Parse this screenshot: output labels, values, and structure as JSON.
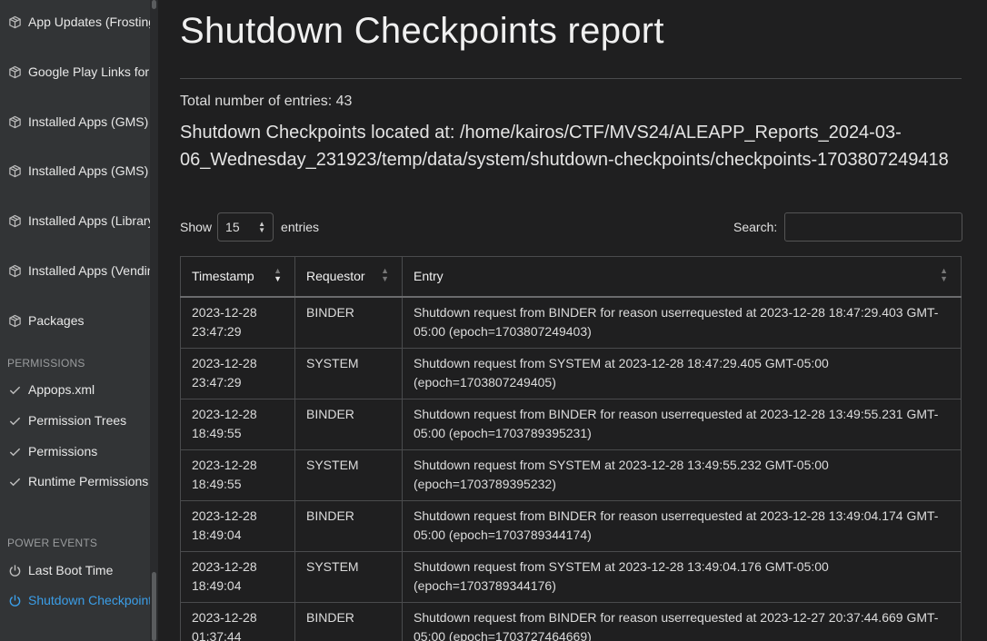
{
  "sidebar": {
    "items_top": [
      {
        "label": "App Updates (Frosting.db)",
        "icon": "package-icon"
      },
      {
        "label": "Google Play Links for Apps",
        "icon": "package-icon"
      },
      {
        "label": "Installed Apps (GMS)",
        "icon": "package-icon"
      },
      {
        "label": "Installed Apps (GMS) for user",
        "icon": "package-icon"
      },
      {
        "label": "Installed Apps (Library)",
        "icon": "package-icon"
      },
      {
        "label": "Installed Apps (Vending)",
        "icon": "package-icon"
      },
      {
        "label": "Packages",
        "icon": "package-icon"
      }
    ],
    "permissions_header": "PERMISSIONS",
    "permissions": [
      {
        "label": "Appops.xml",
        "icon": "check-icon"
      },
      {
        "label": "Permission Trees",
        "icon": "check-icon"
      },
      {
        "label": "Permissions",
        "icon": "check-icon"
      },
      {
        "label": "Runtime Permissions",
        "icon": "check-icon"
      }
    ],
    "power_header": "POWER EVENTS",
    "power": [
      {
        "label": "Last Boot Time",
        "icon": "power-icon"
      },
      {
        "label": "Shutdown Checkpoints",
        "icon": "power-icon",
        "active": true
      }
    ]
  },
  "main": {
    "title": "Shutdown Checkpoints report",
    "total": "Total number of entries: 43",
    "located": "Shutdown Checkpoints located at: /home/kairos/CTF/MVS24/ALEAPP_Reports_2024-03-06_Wednesday_231923/temp/data/system/shutdown-checkpoints/checkpoints-1703807249418",
    "show_label": "Show",
    "page_size": "15",
    "entries_label": "entries",
    "search_label": "Search:"
  },
  "table": {
    "headers": [
      "Timestamp",
      "Requestor",
      "Entry"
    ],
    "rows": [
      [
        "2023-12-28 23:47:29",
        "BINDER",
        "Shutdown request from BINDER for reason userrequested at 2023-12-28 18:47:29.403 GMT-05:00 (epoch=1703807249403)"
      ],
      [
        "2023-12-28 23:47:29",
        "SYSTEM",
        "Shutdown request from SYSTEM at 2023-12-28 18:47:29.405 GMT-05:00 (epoch=1703807249405)"
      ],
      [
        "2023-12-28 18:49:55",
        "BINDER",
        "Shutdown request from BINDER for reason userrequested at 2023-12-28 13:49:55.231 GMT-05:00 (epoch=1703789395231)"
      ],
      [
        "2023-12-28 18:49:55",
        "SYSTEM",
        "Shutdown request from SYSTEM at 2023-12-28 13:49:55.232 GMT-05:00 (epoch=1703789395232)"
      ],
      [
        "2023-12-28 18:49:04",
        "BINDER",
        "Shutdown request from BINDER for reason userrequested at 2023-12-28 13:49:04.174 GMT-05:00 (epoch=1703789344174)"
      ],
      [
        "2023-12-28 18:49:04",
        "SYSTEM",
        "Shutdown request from SYSTEM at 2023-12-28 13:49:04.176 GMT-05:00 (epoch=1703789344176)"
      ],
      [
        "2023-12-28 01:37:44",
        "BINDER",
        "Shutdown request from BINDER for reason userrequested at 2023-12-27 20:37:44.669 GMT-05:00 (epoch=1703727464669)"
      ]
    ]
  },
  "colors": {
    "sidebar_bg": "#323436",
    "main_bg": "#1f1f20",
    "active": "#3b9ee8",
    "border": "#4a4b4d"
  }
}
